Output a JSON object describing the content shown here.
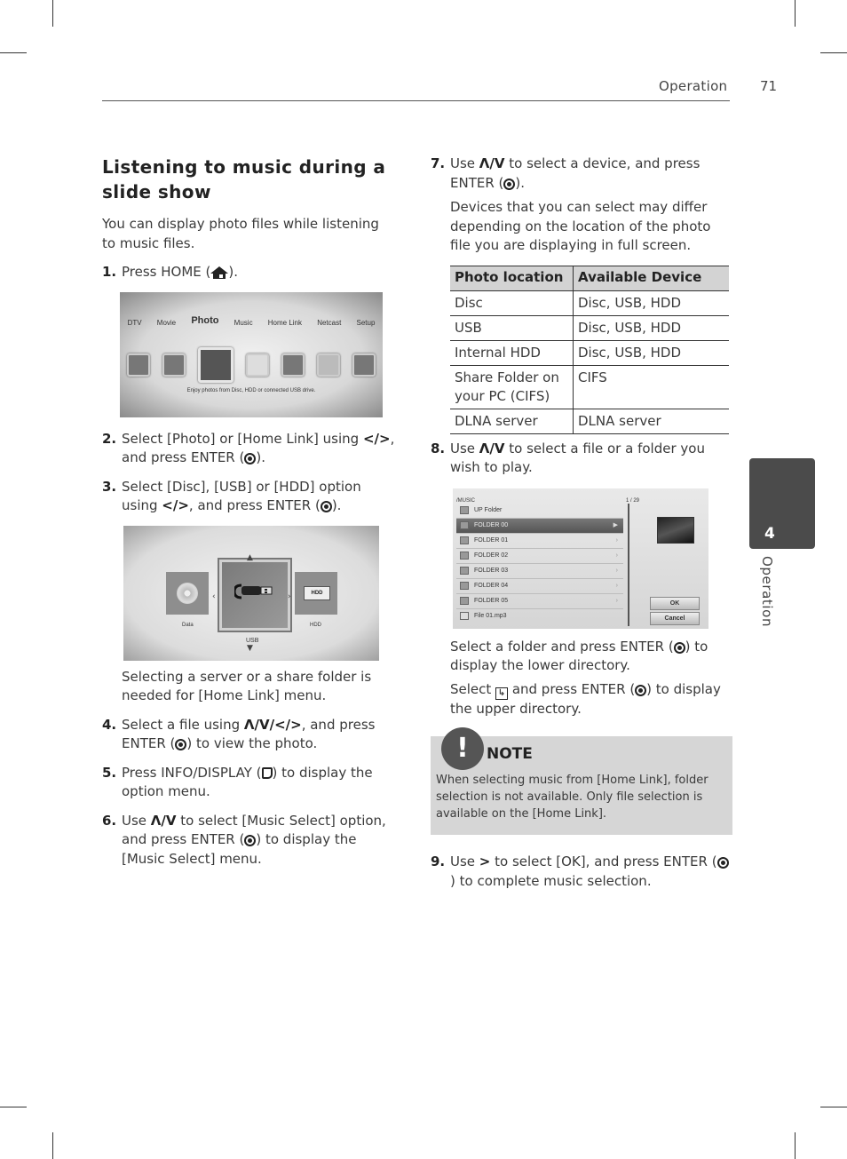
{
  "header": {
    "section": "Operation",
    "page_number": "71"
  },
  "side_tab": {
    "chapter_number": "4",
    "chapter_label": "Operation"
  },
  "left": {
    "title": "Listening to music during a slide show",
    "intro": "You can display photo files while listening to music files.",
    "step1": {
      "num": "1.",
      "text_a": "Press HOME (",
      "text_b": ")."
    },
    "screen1": {
      "menu": [
        "DTV",
        "Movie",
        "Photo",
        "Music",
        "Home Link",
        "Netcast",
        "Setup"
      ],
      "selected": "Photo",
      "caption": "Enjoy photos from Disc, HDD or connected USB drive."
    },
    "step2": {
      "num": "2.",
      "text_a": "Select [Photo] or [Home Link] using ",
      "arrows": "</>",
      "text_b": ", and press ENTER (",
      "text_c": ")."
    },
    "step3": {
      "num": "3.",
      "text_a": "Select [Disc], [USB] or [HDD] option using ",
      "arrows": "</>",
      "text_b": ", and press ENTER (",
      "text_c": ")."
    },
    "screen2": {
      "left_label": "Data",
      "center_label": "USB",
      "right_label": "HDD",
      "hdd_badge": "HDD"
    },
    "screen2_caption": "Selecting a server or a share folder is needed for [Home Link] menu.",
    "step4": {
      "num": "4.",
      "text_a": "Select a file using ",
      "arrows": "Λ/V/</>",
      "text_b": ", and press ENTER (",
      "text_c": ") to view the photo."
    },
    "step5": {
      "num": "5.",
      "text_a": "Press INFO/DISPLAY (",
      "text_b": ") to display the option menu."
    },
    "step6": {
      "num": "6.",
      "text_a": "Use ",
      "arrows": "Λ/V",
      "text_b": " to select [Music Select] option, and press ENTER (",
      "text_c": ") to display the [Music Select] menu."
    }
  },
  "right": {
    "step7": {
      "num": "7.",
      "text_a": "Use ",
      "arrows": "Λ/V",
      "text_b": " to select a device, and press ENTER (",
      "text_c": ")."
    },
    "step7_note": "Devices that you can select may differ depending on the location of the photo file you are displaying in full screen.",
    "table": {
      "headers": [
        "Photo location",
        "Available Device"
      ],
      "rows": [
        [
          "Disc",
          "Disc, USB, HDD"
        ],
        [
          "USB",
          "Disc, USB, HDD"
        ],
        [
          "Internal HDD",
          "Disc, USB, HDD"
        ],
        [
          "Share Folder on your PC (CIFS)",
          "CIFS"
        ],
        [
          "DLNA server",
          "DLNA server"
        ]
      ]
    },
    "step8": {
      "num": "8.",
      "text_a": "Use ",
      "arrows": "Λ/V",
      "text_b": " to select a file or a folder you wish to play."
    },
    "screen3": {
      "path": "/MUSIC",
      "count": "1 / 29",
      "items": [
        "UP Folder",
        "FOLDER 00",
        "FOLDER 01",
        "FOLDER 02",
        "FOLDER 03",
        "FOLDER 04",
        "FOLDER 05",
        "File 01.mp3"
      ],
      "selected_index": 1,
      "ok_label": "OK",
      "cancel_label": "Cancel"
    },
    "step8_note1": {
      "text_a": "Select a folder and press ENTER (",
      "text_b": ") to display the lower directory."
    },
    "step8_note2": {
      "text_a": "Select ",
      "text_b": " and press ENTER (",
      "text_c": ") to display the upper directory."
    },
    "note": {
      "badge": "!",
      "title": "NOTE",
      "body": "When selecting music from [Home Link], folder selection is not available. Only file selection is available on the [Home Link]."
    },
    "step9": {
      "num": "9.",
      "text_a": "Use ",
      "arrows": ">",
      "text_b": " to select [OK], and press ENTER (",
      "text_c": ") to complete music selection."
    }
  }
}
